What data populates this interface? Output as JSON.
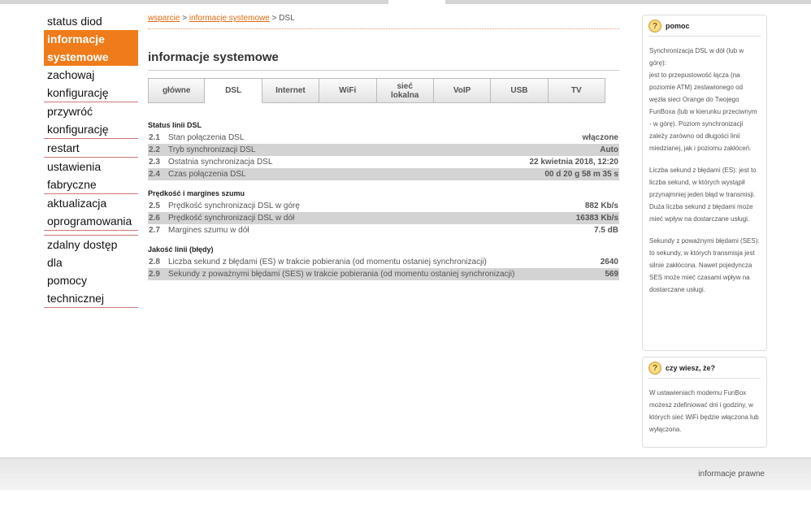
{
  "left_nav": {
    "items": [
      {
        "lines": [
          "status diod"
        ]
      },
      {
        "lines": [
          "informacje",
          "systemowe"
        ],
        "active": true
      },
      {
        "lines": [
          "zachowaj",
          "konfigurację"
        ]
      },
      {
        "lines": [
          "przywróć",
          "konfigurację"
        ]
      },
      {
        "lines": [
          "restart"
        ]
      },
      {
        "lines": [
          "ustawienia",
          "fabryczne"
        ]
      },
      {
        "lines": [
          "aktualizacja",
          "oprogramowania"
        ]
      },
      {
        "lines": [
          "zdalny dostęp dla",
          "pomocy",
          "technicznej"
        ]
      }
    ]
  },
  "breadcrumb": {
    "link1": "wsparcie",
    "sep1": " > ",
    "link2": "informacje systemowe",
    "sep2": " > ",
    "current": "DSL"
  },
  "page_title": "informacje systemowe",
  "tabs": [
    {
      "label": "główne"
    },
    {
      "label": "DSL",
      "active": true
    },
    {
      "label": "Internet"
    },
    {
      "label": "WiFi"
    },
    {
      "label": "sieć\nlokalna"
    },
    {
      "label": "VoIP"
    },
    {
      "label": "USB"
    },
    {
      "label": "TV"
    }
  ],
  "sections": [
    {
      "title": "Status linii DSL",
      "rows": [
        {
          "num": "2.1",
          "label": "Stan połączenia DSL",
          "value": "włączone"
        },
        {
          "num": "2.2",
          "label": "Tryb synchronizacji DSL",
          "value": "Auto"
        },
        {
          "num": "2.3",
          "label": "Ostatnia synchronizacja DSL",
          "value": "22 kwietnia 2018, 12:20"
        },
        {
          "num": "2.4",
          "label": "Czas połączenia DSL",
          "value": "00 d 20 g 58 m 35 s"
        }
      ]
    },
    {
      "title": "Prędkość i margines szumu",
      "rows": [
        {
          "num": "2.5",
          "label": "Prędkość synchronizacji DSL w górę",
          "value": "882 Kb/s"
        },
        {
          "num": "2.6",
          "label": "Prędkość synchronizacji DSL w dół",
          "value": "16383 Kb/s"
        },
        {
          "num": "2.7",
          "label": "Margines szumu w dół",
          "value": "7.5 dB"
        }
      ]
    },
    {
      "title": "Jakość linii (błędy)",
      "rows": [
        {
          "num": "2.8",
          "label": "Liczba sekund z błędami (ES) w trakcie pobierania (od momentu ostaniej synchronizacji)",
          "value": "2640"
        },
        {
          "num": "2.9",
          "label": "Sekundy z poważnymi błędami (SES) w trakcie pobierania (od momentu ostaniej synchronizacji)",
          "value": "569"
        }
      ]
    }
  ],
  "help_panel": {
    "icon": "question-icon",
    "title": "pomoc",
    "paragraphs": [
      "Synchronizacja DSL w dół (lub w górę):\njest to przepustowość łącza (na poziomie ATM) zestawionego od węzła sieci Orange do Twojego FunBoxa (lub w kierunku przeciwnym - w górę). Poziom synchronizacji zależy zarówno od długości linii miedzianej, jak i poziomu zakłóceń.",
      "Liczba sekund z błędami (ES): jest to liczba sekund, w których wystąpił przynajmniej jeden błąd w transmisji. Duża liczba sekund z błędami może mieć wpływ na dostarczane usługi.",
      "Sekundy z poważnymi błędami (SES): to sekundy, w których transmisja jest silnie zakłócona. Nawet pojedyncza SES może mieć czasami wpływ na dostarczane usługi."
    ]
  },
  "know_panel": {
    "icon": "question-icon",
    "title": "czy wiesz, że?",
    "text": "W ustawieniach modemu FunBox możesz zdefiniować dni i godziny, w których sieć WiFi będzie włączona lub wyłączona."
  },
  "footer": {
    "link": "informacje prawne"
  },
  "colors": {
    "accent": "#ef7b1a",
    "row_shade": "#d3d3d3"
  }
}
